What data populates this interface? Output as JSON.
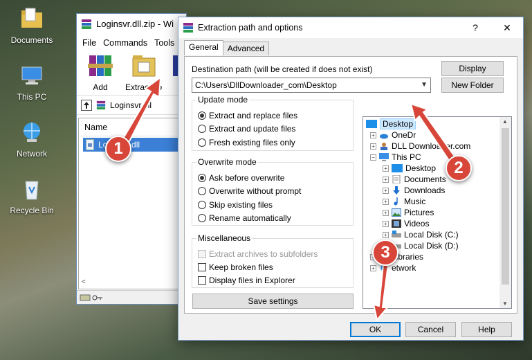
{
  "desktop": {
    "icons": [
      {
        "label": "Documents"
      },
      {
        "label": "This PC"
      },
      {
        "label": "Network"
      },
      {
        "label": "Recycle Bin"
      }
    ]
  },
  "winrar": {
    "title": "Loginsvr.dll.zip - Wi",
    "menu": [
      "File",
      "Commands",
      "Tools"
    ],
    "toolbar": {
      "add": "Add",
      "extract_to": "Extract To"
    },
    "path": "Loginsvr.dll",
    "list_header": "Name",
    "file": "Loginsvr.dll"
  },
  "dialog": {
    "title": "Extraction path and options",
    "help_glyph": "?",
    "close_glyph": "✕",
    "tabs": [
      "General",
      "Advanced"
    ],
    "dest_label": "Destination path (will be created if does not exist)",
    "dest_value": "C:\\Users\\DllDownloader_com\\Desktop",
    "display_btn": "Display",
    "new_folder_btn": "New Folder",
    "update_mode": {
      "label": "Update mode",
      "options": [
        "Extract and replace files",
        "Extract and update files",
        "Fresh existing files only"
      ],
      "selected": 0
    },
    "overwrite_mode": {
      "label": "Overwrite mode",
      "options": [
        "Ask before overwrite",
        "Overwrite without prompt",
        "Skip existing files",
        "Rename automatically"
      ],
      "selected": 0
    },
    "misc": {
      "label": "Miscellaneous",
      "options": [
        "Extract archives to subfolders",
        "Keep broken files",
        "Display files in Explorer"
      ]
    },
    "save_settings": "Save settings",
    "tree": {
      "desktop": "Desktop",
      "onedrive": "OneDr",
      "user": "DLL Downloader.com",
      "this_pc": "This PC",
      "pc_items": [
        "Desktop",
        "Documents",
        "Downloads",
        "Music",
        "Pictures",
        "Videos",
        "Local Disk (C:)",
        "Local Disk (D:)"
      ],
      "libraries": "Libraries",
      "network": "etwork"
    },
    "buttons": {
      "ok": "OK",
      "cancel": "Cancel",
      "help": "Help"
    }
  },
  "markers": [
    "1",
    "2",
    "3"
  ],
  "colors": {
    "marker": "#d8463a",
    "selection": "#3b7fd6",
    "accent": "#0078d7"
  }
}
